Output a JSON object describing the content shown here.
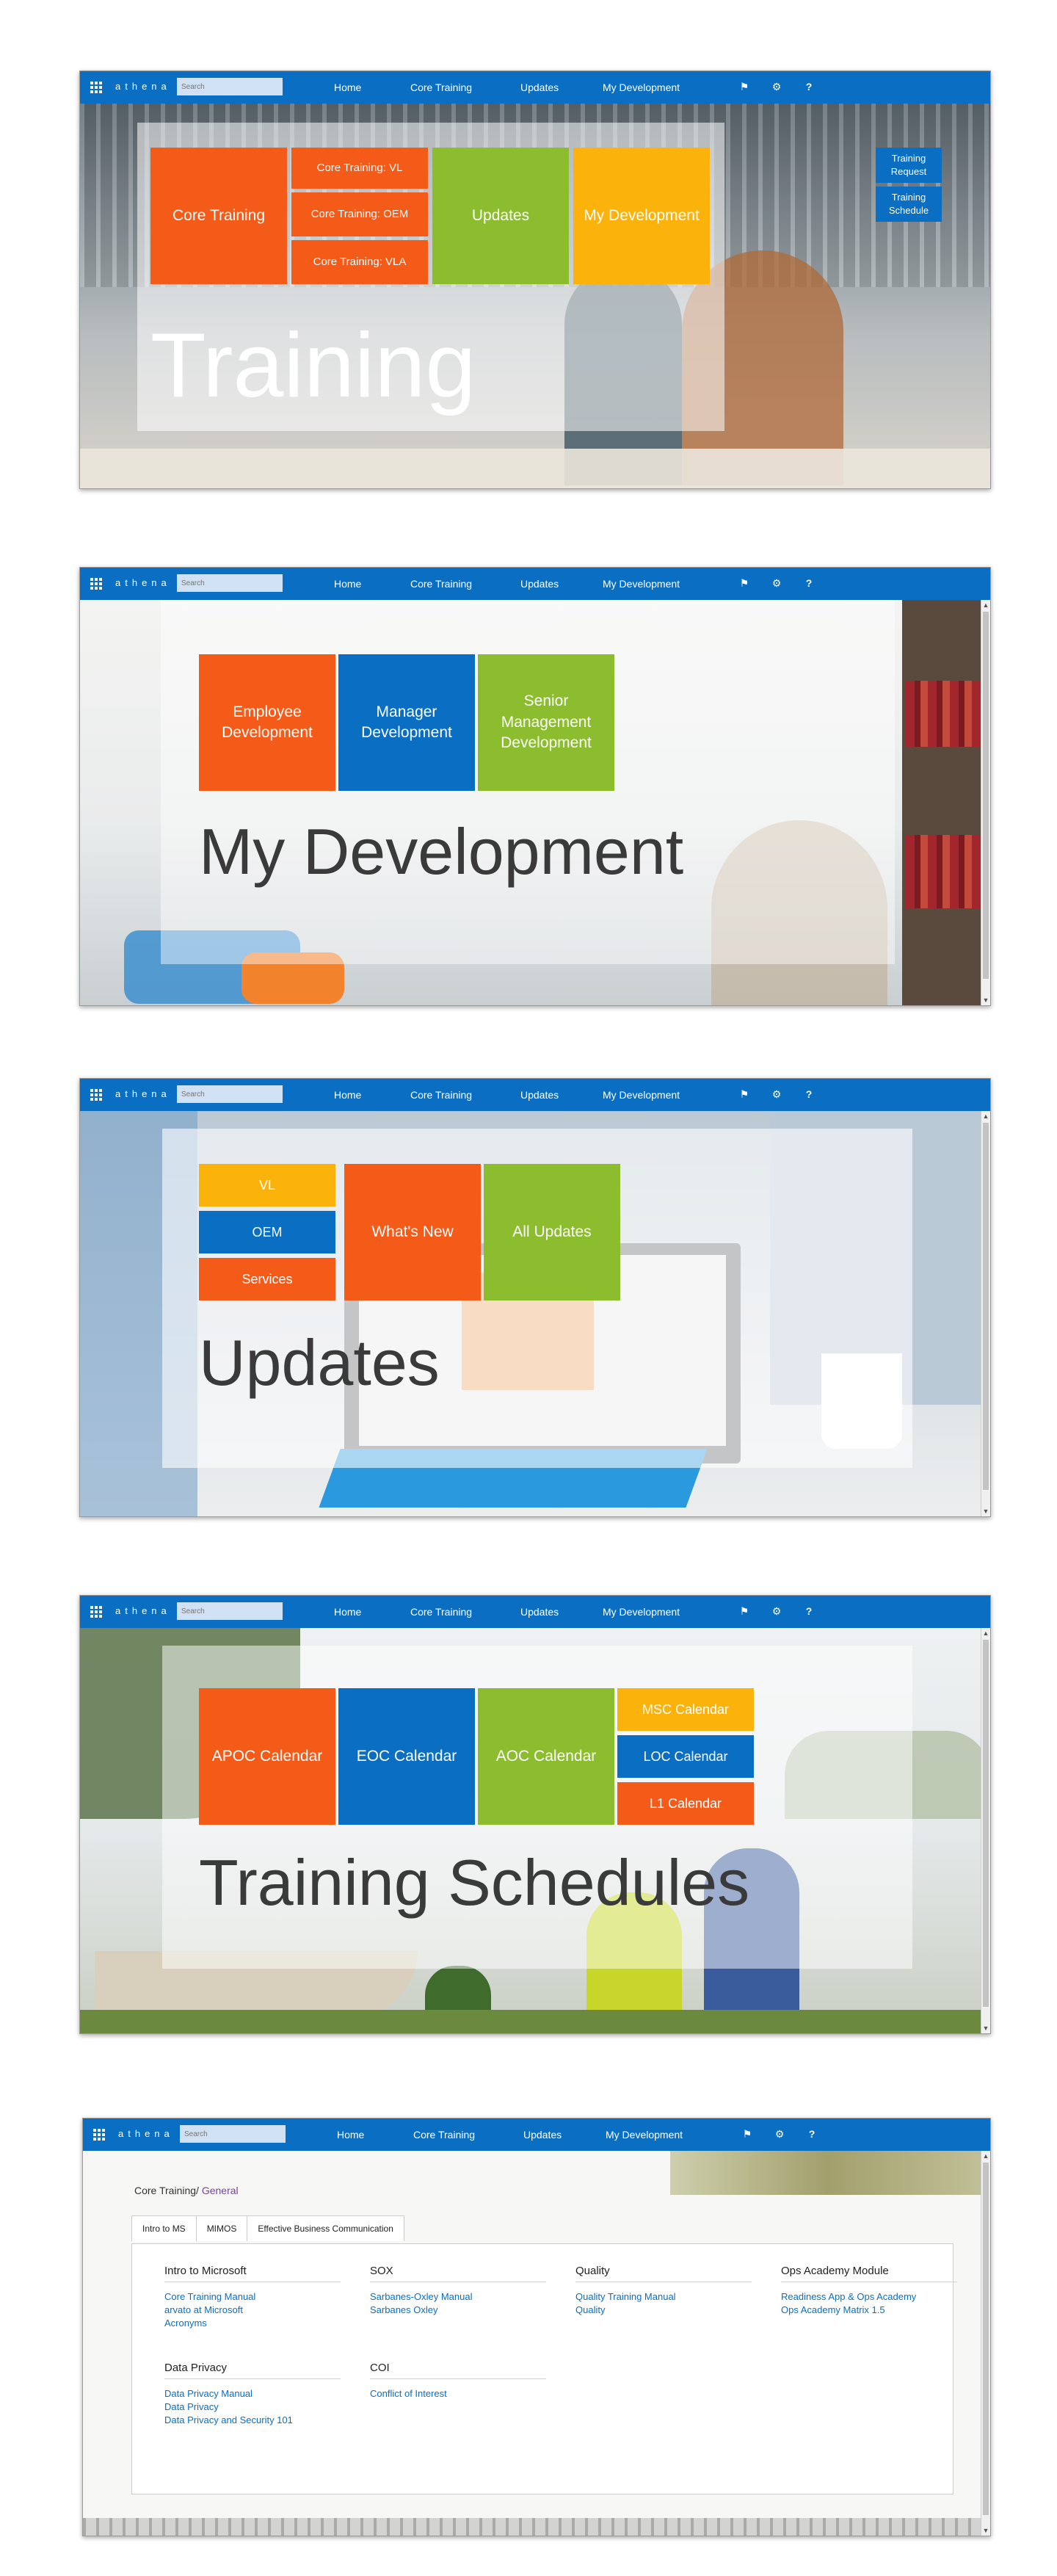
{
  "topbar": {
    "brand": "athena",
    "search_placeholder": "Search",
    "nav": [
      "Home",
      "Core Training",
      "Updates",
      "My Development"
    ]
  },
  "panel1": {
    "title": "Training",
    "tiles": {
      "core": "Core Training",
      "vl": "Core Training: VL",
      "oem": "Core Training: OEM",
      "vla": "Core Training: VLA",
      "updates": "Updates",
      "mydev": "My Development"
    },
    "buttons": [
      "Training Request",
      "Training Schedule"
    ]
  },
  "panel2": {
    "title": "My Development",
    "tiles": [
      "Employee Development",
      "Manager Development",
      "Senior Management Development"
    ]
  },
  "panel3": {
    "title": "Updates",
    "tiles": {
      "vl": "VL",
      "oem": "OEM",
      "services": "Services",
      "whatsnew": "What's New",
      "all": "All Updates"
    }
  },
  "panel4": {
    "title": "Training Schedules",
    "tiles": {
      "apoc": "APOC Calendar",
      "eoc": "EOC Calendar",
      "aoc": "AOC Calendar",
      "msc": "MSC Calendar",
      "loc": "LOC Calendar",
      "l1": "L1 Calendar"
    }
  },
  "panel5": {
    "breadcrumb_root": "Core Training/",
    "breadcrumb_current": "General",
    "tabs": [
      "Intro to MS",
      "MIMOS",
      "Effective Business Communication"
    ],
    "sections": [
      {
        "heading": "Intro to Microsoft",
        "links": [
          "Core Training Manual",
          "arvato at Microsoft",
          "Acronyms"
        ]
      },
      {
        "heading": "SOX",
        "links": [
          "Sarbanes-Oxley Manual",
          "Sarbanes Oxley"
        ]
      },
      {
        "heading": "Quality",
        "links": [
          "Quality Training Manual",
          "Quality"
        ]
      },
      {
        "heading": "Ops Academy Module",
        "links": [
          "Readiness App & Ops Academy",
          "Ops Academy Matrix 1.5"
        ]
      },
      {
        "heading": "Data Privacy",
        "links": [
          "Data Privacy Manual",
          "Data Privacy",
          "Data Privacy and Security 101"
        ]
      },
      {
        "heading": "COI",
        "links": [
          "Conflict of Interest"
        ]
      }
    ]
  },
  "colors": {
    "orange": "#f45b19",
    "green": "#8cbd2e",
    "amber": "#fbb20a",
    "blue": "#0a6fc2",
    "link": "#0a6fc2"
  },
  "icons": [
    "app-launcher-icon",
    "bell-icon",
    "gear-icon",
    "help-icon",
    "scroll-up-icon",
    "scroll-down-icon"
  ]
}
